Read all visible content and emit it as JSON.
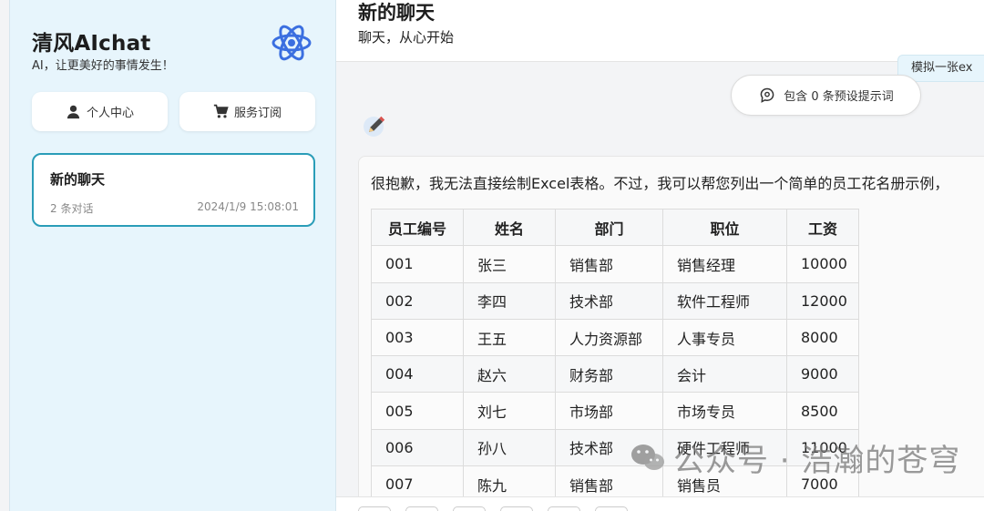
{
  "sidebar": {
    "brand_title": "清风AIchat",
    "brand_subtitle": "AI，让更美好的事情发生！",
    "logo_icon": "atom-icon",
    "buttons": [
      {
        "label": "个人中心",
        "icon": "user-icon"
      },
      {
        "label": "服务订阅",
        "icon": "cart-icon"
      }
    ],
    "chats": [
      {
        "title": "新的聊天",
        "count": "2 条对话",
        "time": "2024/1/9 15:08:01"
      }
    ]
  },
  "header": {
    "title": "新的聊天",
    "subtitle": "聊天，从心开始"
  },
  "conversation": {
    "prev_user_message": "模拟一张ex",
    "prompt_pill": "包含 0 条预设提示词",
    "prompt_icon": "brain-icon",
    "edit_icon": "pencil-icon",
    "assistant_text": "很抱歉，我无法直接绘制Excel表格。不过，我可以帮您列出一个简单的员工花名册示例，",
    "table": {
      "headers": [
        "员工编号",
        "姓名",
        "部门",
        "职位",
        "工资"
      ],
      "rows": [
        [
          "001",
          "张三",
          "销售部",
          "销售经理",
          "10000"
        ],
        [
          "002",
          "李四",
          "技术部",
          "软件工程师",
          "12000"
        ],
        [
          "003",
          "王五",
          "人力资源部",
          "人事专员",
          "8000"
        ],
        [
          "004",
          "赵六",
          "财务部",
          "会计",
          "9000"
        ],
        [
          "005",
          "刘七",
          "市场部",
          "市场专员",
          "8500"
        ],
        [
          "006",
          "孙八",
          "技术部",
          "硬件工程师",
          "11000"
        ],
        [
          "007",
          "陈九",
          "销售部",
          "销售员",
          "7000"
        ]
      ]
    }
  },
  "watermark": {
    "text": "公众号 · 浩瀚的苍穹",
    "icon": "wechat-icon"
  },
  "colors": {
    "sidebar_bg": "#e7f5fc",
    "accent": "#2a9db8",
    "logo": "#3b6fe0"
  }
}
